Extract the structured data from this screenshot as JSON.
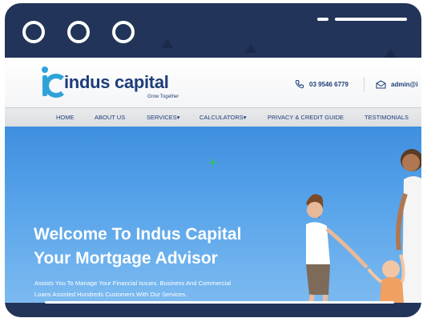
{
  "brand": {
    "name": "indus capital",
    "tagline": "Grow Together"
  },
  "contact": {
    "phone": "03 9546 6779",
    "email": "admin@i"
  },
  "nav": {
    "items": [
      {
        "label": "HOME"
      },
      {
        "label": "ABOUT US"
      },
      {
        "label": "SERVICES▾"
      },
      {
        "label": "CALCULATORS▾"
      },
      {
        "label": "PRIVACY & CREDIT GUIDE"
      },
      {
        "label": "TESTIMONIALS"
      }
    ]
  },
  "hero": {
    "title_line1": "Welcome To Indus Capital",
    "title_line2": "Your Mortgage Advisor",
    "subtitle_line1": "Assists You To Manage Your Financial Issues. Business And Commercial",
    "subtitle_line2": "Loans Assisted Hundreds Customers With Our Services."
  },
  "icons": {
    "phone": "phone-icon",
    "email": "envelope-icon",
    "cursor": "crosshair-cursor-icon"
  },
  "colors": {
    "frame": "#223459",
    "brand": "#1d3d7a",
    "accent": "#2fa3d9",
    "sky": "#58a4ea"
  }
}
